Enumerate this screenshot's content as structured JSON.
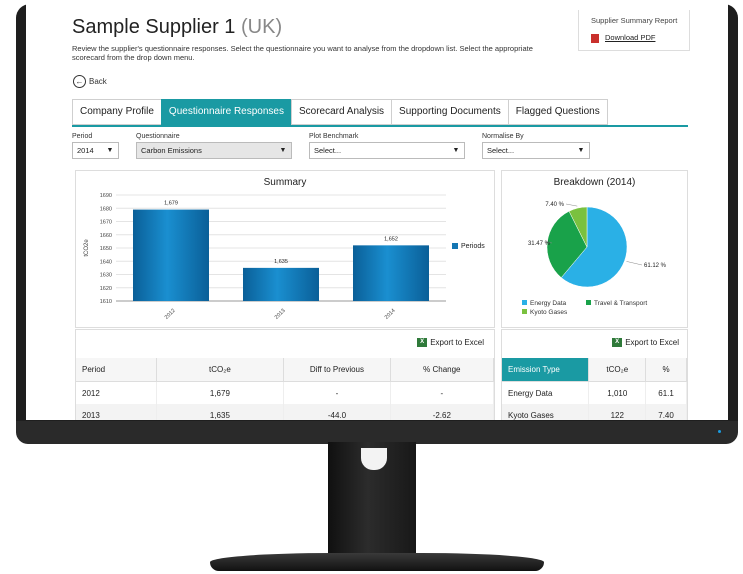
{
  "header": {
    "supplier_name": "Sample Supplier 1",
    "country": "(UK)",
    "intro": "Review the supplier's questionnaire responses. Select the questionnaire you want to analyse from the dropdown list. Select the appropriate scorecard from the drop down menu."
  },
  "report": {
    "title": "Supplier Summary Report",
    "download_label": "Download PDF"
  },
  "nav": {
    "back_label": "Back"
  },
  "tabs": [
    {
      "label": "Company Profile"
    },
    {
      "label": "Questionnaire Responses",
      "active": true
    },
    {
      "label": "Scorecard Analysis"
    },
    {
      "label": "Supporting Documents"
    },
    {
      "label": "Flagged Questions"
    }
  ],
  "filters": {
    "period": {
      "label": "Period",
      "value": "2014"
    },
    "questionnaire": {
      "label": "Questionnaire",
      "value": "Carbon Emissions"
    },
    "benchmark": {
      "label": "Plot Benchmark",
      "value": "Select..."
    },
    "normalise": {
      "label": "Normalise By",
      "value": "Select..."
    }
  },
  "summary_table": {
    "export_label": "Export to Excel",
    "headers": [
      "Period",
      "tCO₂e",
      "Diff to Previous",
      "% Change"
    ],
    "rows": [
      [
        "2012",
        "1,679",
        "-",
        "-"
      ],
      [
        "2013",
        "1,635",
        "-44.0",
        "-2.62"
      ]
    ]
  },
  "breakdown_table": {
    "export_label": "Export to Excel",
    "headers": [
      "Emission Type",
      "tCO₂e",
      "%"
    ],
    "rows": [
      [
        "Energy Data",
        "1,010",
        "61.1"
      ],
      [
        "Kyoto Gases",
        "122",
        "7.40"
      ]
    ]
  },
  "chart_data": [
    {
      "type": "bar",
      "title": "Summary",
      "ylabel": "tCO2e",
      "categories": [
        "2012",
        "2013",
        "2014"
      ],
      "series": [
        {
          "name": "Periods",
          "values": [
            1679,
            1635,
            1652
          ]
        }
      ],
      "data_labels": [
        "1,679",
        "1,635",
        "1,652"
      ],
      "ylim": [
        1610,
        1690
      ],
      "yticks": [
        1610,
        1620,
        1630,
        1640,
        1650,
        1660,
        1670,
        1680,
        1690
      ],
      "grid": true,
      "legend": "right",
      "color": "#1476b3"
    },
    {
      "type": "pie",
      "title": "Breakdown (2014)",
      "labels": [
        "Energy Data",
        "Travel & Transport",
        "Kyoto Gases"
      ],
      "values": [
        61.12,
        31.47,
        7.4
      ],
      "data_labels": [
        "61.12 %",
        "31.47 %",
        "7.40 %"
      ],
      "colors": [
        "#2ab0e6",
        "#19a24a",
        "#7ac13f"
      ],
      "legend": "bottom"
    }
  ]
}
